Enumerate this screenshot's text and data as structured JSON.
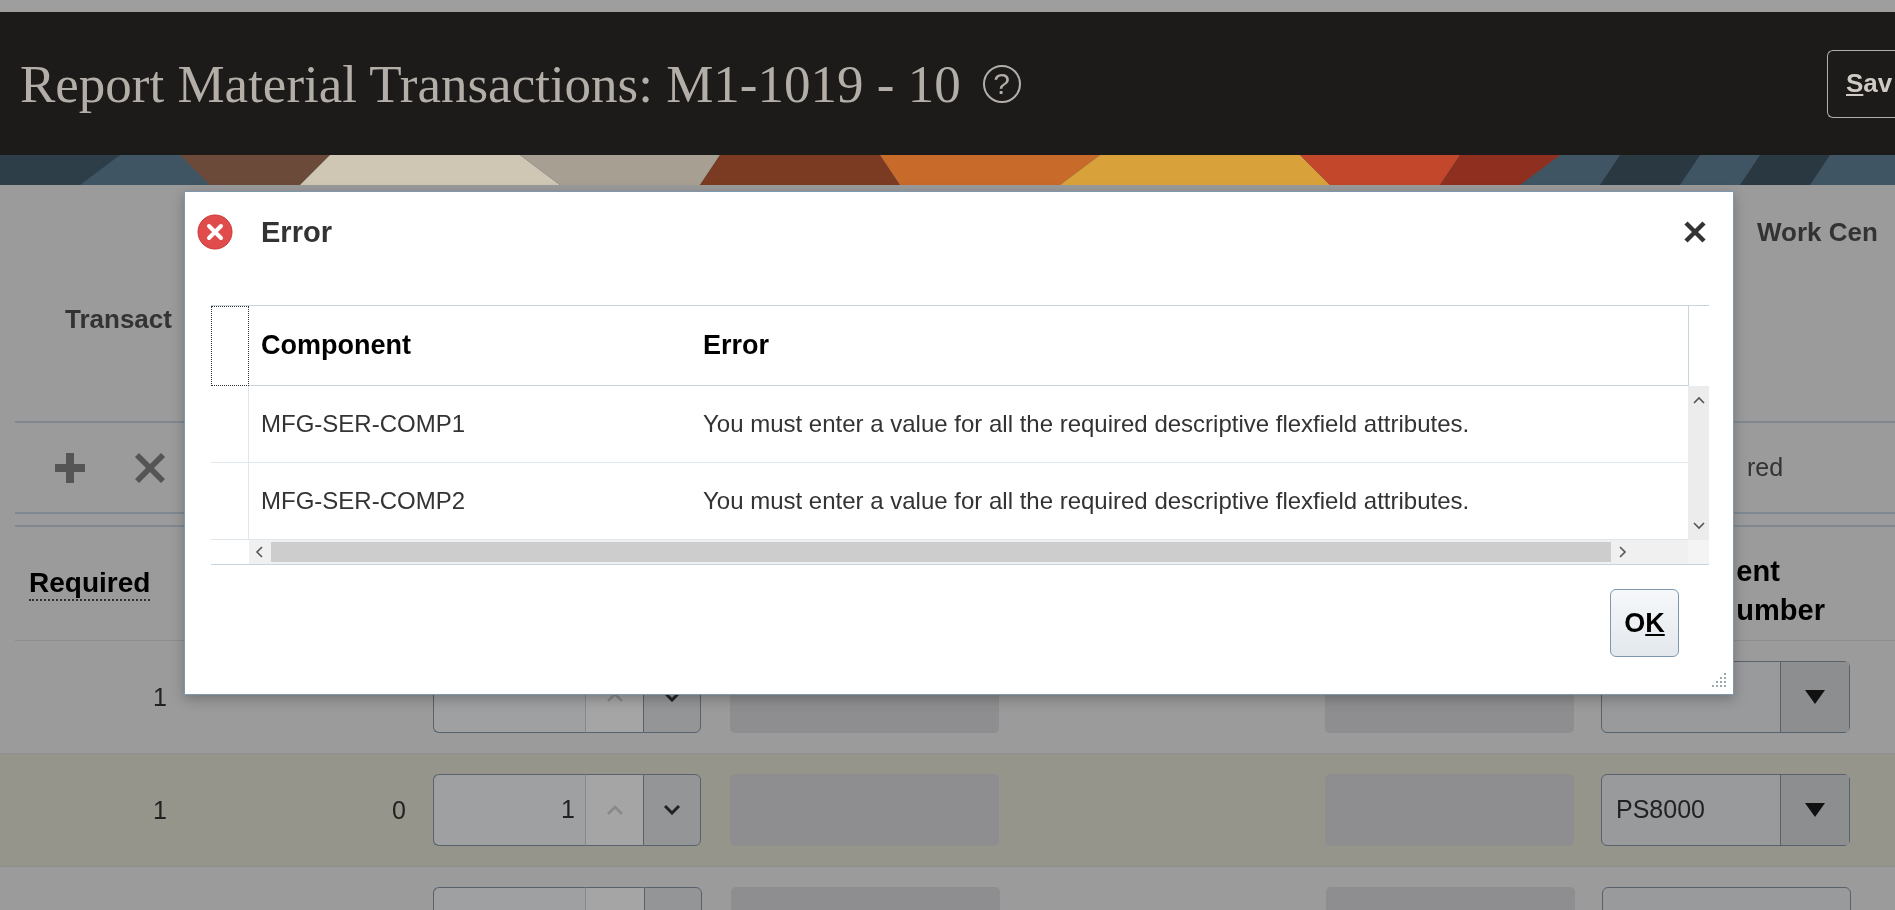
{
  "header": {
    "title": "Report Material Transactions: M1-1019 - 10",
    "help_glyph": "?",
    "save_button": "Sav"
  },
  "page": {
    "work_center_label": "Work Cen",
    "transaction_label": "Transact",
    "toolbar_text": "red",
    "required_header": "Required",
    "column_header_lines": [
      "ent",
      "umber"
    ],
    "rows": [
      {
        "required": "1",
        "selected": false
      },
      {
        "required": "1",
        "issued": "0",
        "quantity": "1",
        "subinventory": "PS8000",
        "selected": true
      }
    ]
  },
  "dialog": {
    "title": "Error",
    "columns": [
      "Component",
      "Error"
    ],
    "rows": [
      {
        "component": "MFG-SER-COMP1",
        "error": "You must enter a value for all the required descriptive flexfield attributes."
      },
      {
        "component": "MFG-SER-COMP2",
        "error": "You must enter a value for all the required descriptive flexfield attributes."
      }
    ],
    "ok_button": "OK"
  }
}
